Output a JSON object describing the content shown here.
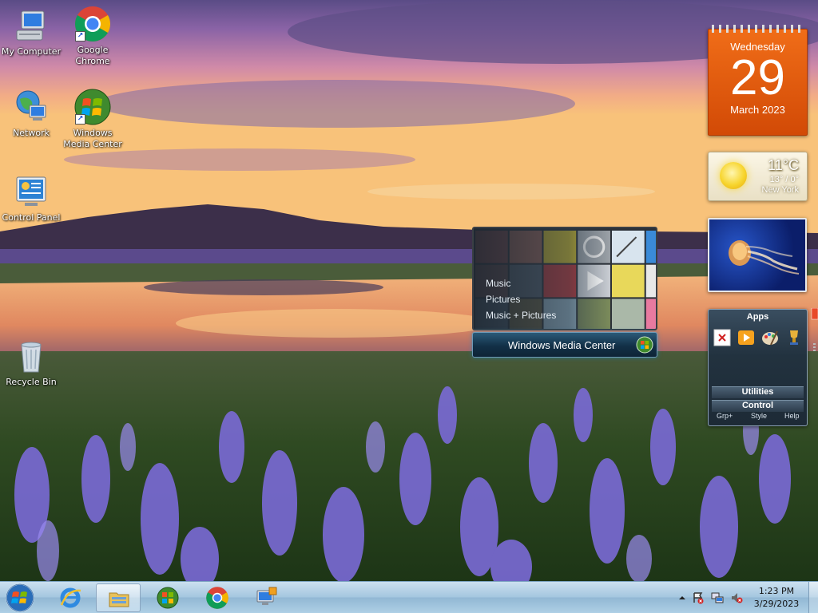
{
  "desktop": {
    "icons": [
      {
        "label_1": "My Computer",
        "label_2": "",
        "icon": "computer-icon"
      },
      {
        "label_1": "Google",
        "label_2": "Chrome",
        "icon": "chrome-icon"
      },
      {
        "label_1": "Network",
        "label_2": "",
        "icon": "network-icon"
      },
      {
        "label_1": "Windows",
        "label_2": "Media Center",
        "icon": "media-center-icon"
      },
      {
        "label_1": "Control Panel",
        "label_2": "",
        "icon": "control-panel-icon"
      },
      {
        "label_1": "Recycle Bin",
        "label_2": "",
        "icon": "recycle-bin-icon"
      }
    ]
  },
  "gadgets": {
    "calendar": {
      "weekday": "Wednesday",
      "day": "29",
      "month_year": "March 2023",
      "color": "#e85c10"
    },
    "weather": {
      "temp": "11°C",
      "range": "13° / 0°",
      "city": "New York",
      "icon": "sun-icon"
    },
    "slideshow": {
      "icon": "jellyfish-image"
    },
    "apps": {
      "title": "Apps",
      "sections": [
        "Utilities",
        "Control"
      ],
      "footer": [
        "Grp+",
        "Style",
        "Help"
      ],
      "icons": [
        "close-box-icon",
        "media-player-icon",
        "paint-icon",
        "trophy-icon"
      ]
    },
    "media_center": {
      "items": [
        "Music",
        "Pictures",
        "Music + Pictures"
      ],
      "bar_label": "Windows Media Center"
    }
  },
  "taskbar": {
    "pinned": [
      "internet-explorer-icon",
      "file-explorer-icon",
      "media-center-icon",
      "chrome-icon",
      "remote-desktop-icon"
    ],
    "active": "file-explorer-icon",
    "tray": [
      "show-hidden-icon",
      "action-center-icon",
      "network-icon",
      "volume-muted-icon"
    ],
    "clock": {
      "time": "1:23 PM",
      "date": "3/29/2023"
    }
  },
  "colors": {
    "taskbar": "#a8c8e0",
    "calendar": "#e85c10",
    "media_bar": "#123047"
  }
}
